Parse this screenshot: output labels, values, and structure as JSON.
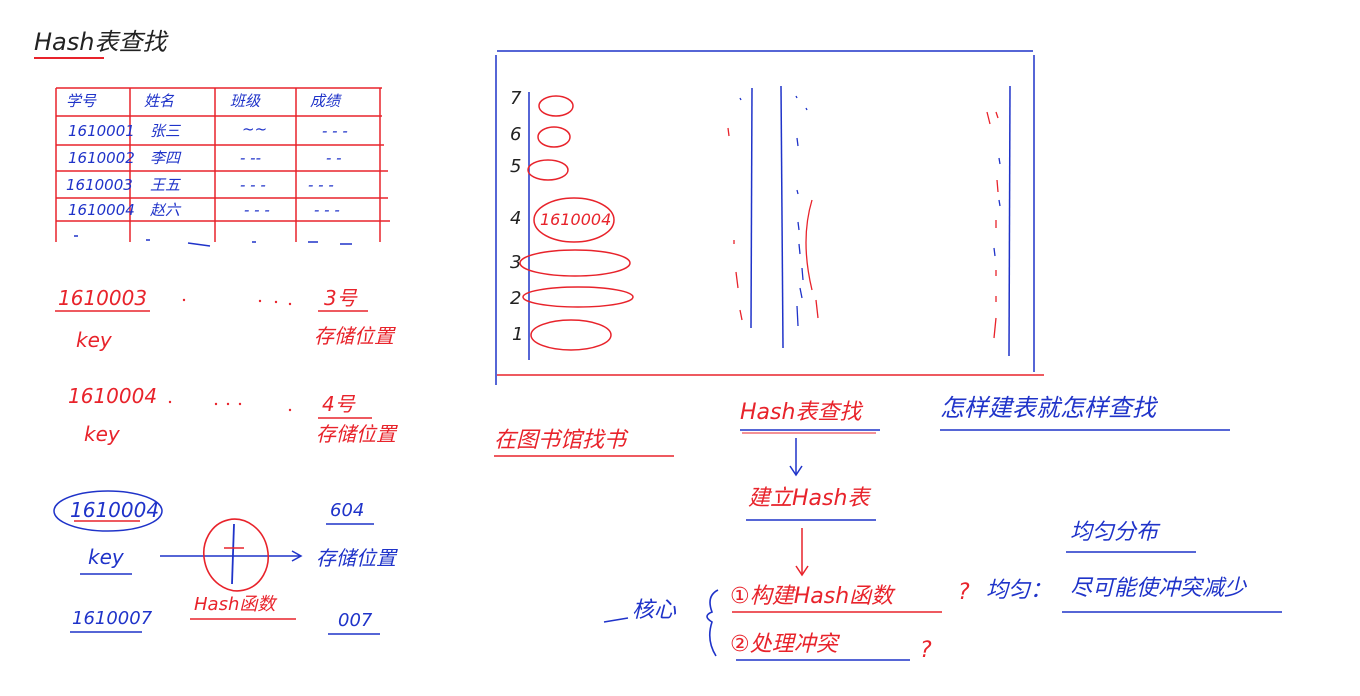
{
  "page_title": "Hash表查找",
  "grade_table": {
    "headers": [
      "学号",
      "姓名",
      "班级",
      "成绩"
    ],
    "rows": [
      [
        "1610001",
        "张三",
        "~~",
        "- - -"
      ],
      [
        "1610002",
        "李四",
        "- --",
        "- -"
      ],
      [
        "1610003",
        "王五",
        "- - -",
        "- - -"
      ],
      [
        "1610004",
        "赵六",
        "- - -",
        "- - -"
      ]
    ]
  },
  "mappings": {
    "row1": {
      "key_value": "1610003",
      "key_label": "key",
      "slot": "3号",
      "slot_label": "存储位置"
    },
    "row2": {
      "key_value": "1610004",
      "key_label": "key",
      "slot": "4号",
      "slot_label": "存储位置"
    },
    "row3": {
      "key_value": "1610004",
      "key_label": "key",
      "function_label": "Hash函数",
      "slot": "604",
      "slot_label": "存储位置"
    },
    "row4": {
      "key_value": "1610007",
      "slot": "007"
    }
  },
  "stack_figure": {
    "row_numbers": [
      "7",
      "6",
      "5",
      "4",
      "3",
      "2",
      "1"
    ],
    "highlight_label": "1610004"
  },
  "notes": {
    "library_analogy": "在图书馆找书",
    "flow_title": "Hash表查找",
    "flow_step": "建立Hash表",
    "quote": "怎样建表就怎样查找",
    "core_label": "核心",
    "point1": "①构建Hash函数",
    "point2": "②处理冲突",
    "q1": "?",
    "q2": "?",
    "rule": "均匀：",
    "rule_detail": "尽可能使冲突减少",
    "distribution": "均匀分布"
  }
}
